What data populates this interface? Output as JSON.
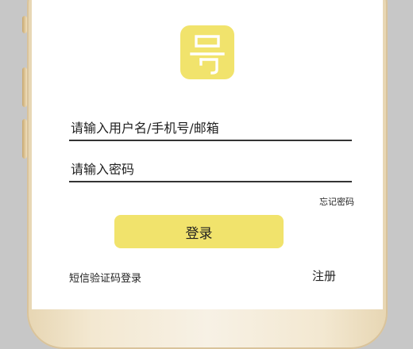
{
  "app": {
    "logo_icon": "hao-character-logo-icon",
    "logo_color": "#f1e36c"
  },
  "login_form": {
    "username_placeholder": "请输入用户名/手机号/邮箱",
    "password_placeholder": "请输入密码",
    "forgot_password_label": "忘记密码",
    "login_button_label": "登录",
    "sms_login_label": "短信验证码登录",
    "register_label": "注册"
  }
}
